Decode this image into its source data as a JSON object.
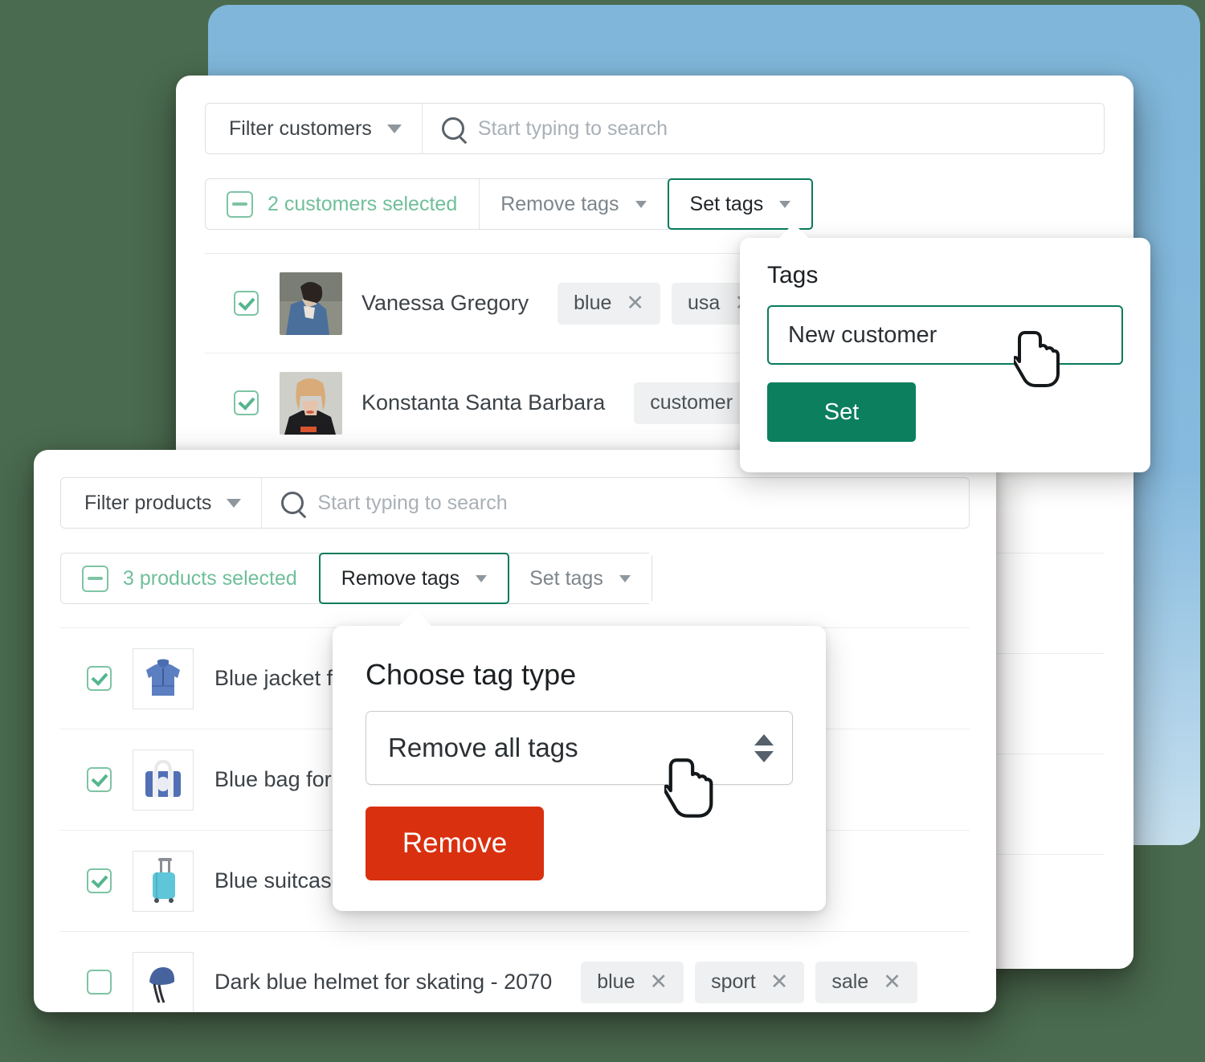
{
  "theme": {
    "accent_green": "#0b7f5e",
    "danger_red": "#d9300f",
    "selected_text_green": "#6fbf9a",
    "backdrop_blue": "#86bade",
    "page_background": "#4a6b4f"
  },
  "customers_panel": {
    "filter_button": {
      "label": "Filter customers",
      "caret_icon": "chevron-down-icon"
    },
    "search": {
      "icon": "search-icon",
      "placeholder": "Start typing to search",
      "value": ""
    },
    "action_bar": {
      "selection_checkbox_state": "indeterminate",
      "selection_label": "2 customers selected",
      "buttons": [
        {
          "label": "Remove tags",
          "active": false
        },
        {
          "label": "Set tags",
          "active": true
        }
      ]
    },
    "rows": [
      {
        "checked": true,
        "name": "Vanessa Gregory",
        "avatar": "woman-in-denim-jacket-photo",
        "tags": [
          "blue",
          "usa"
        ]
      },
      {
        "checked": true,
        "name": "Konstanta Santa Barbara",
        "avatar": "blonde-woman-photo",
        "tags": [
          "customer"
        ]
      }
    ]
  },
  "tags_popover": {
    "title": "Tags",
    "input_value": "New customer",
    "input_placeholder": "",
    "submit_label": "Set"
  },
  "products_panel": {
    "filter_button": {
      "label": "Filter products",
      "caret_icon": "chevron-down-icon"
    },
    "search": {
      "icon": "search-icon",
      "placeholder": "Start typing to search",
      "value": ""
    },
    "action_bar": {
      "selection_checkbox_state": "indeterminate",
      "selection_label": "3 products selected",
      "buttons": [
        {
          "label": "Remove tags",
          "active": true
        },
        {
          "label": "Set tags",
          "active": false
        }
      ]
    },
    "rows": [
      {
        "checked": true,
        "name": "Blue jacket for ",
        "thumb": "blue-hoodie-icon",
        "tags": []
      },
      {
        "checked": true,
        "name": "Blue bag for lap",
        "thumb": "blue-bag-icon",
        "tags": []
      },
      {
        "checked": true,
        "name": "Blue suitcase – ",
        "thumb": "blue-suitcase-icon",
        "tags": []
      },
      {
        "checked": false,
        "name": "Dark blue helmet for skating - 2070",
        "thumb": "blue-helmet-icon",
        "tags": [
          "blue",
          "sport",
          "sale"
        ]
      }
    ]
  },
  "tag_type_popover": {
    "title": "Choose tag type",
    "select_value": "Remove all tags",
    "select_options": [
      "Remove all tags"
    ],
    "submit_label": "Remove"
  },
  "cursors": [
    {
      "name": "pointer-cursor-tags-input"
    },
    {
      "name": "pointer-cursor-tag-type-select"
    }
  ]
}
